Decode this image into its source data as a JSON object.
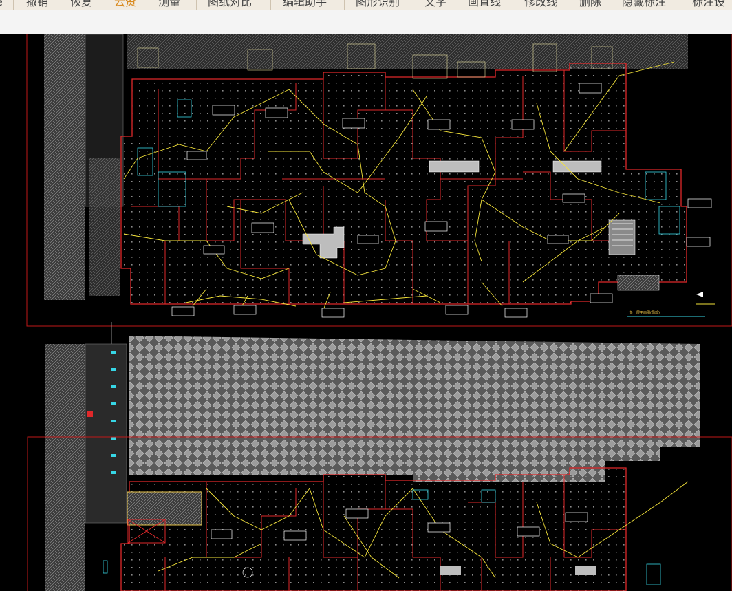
{
  "toolbar": {
    "items": [
      {
        "label": "撤销",
        "active": false
      },
      {
        "label": "恢复",
        "active": false
      },
      {
        "label": "云资",
        "active": true
      },
      {
        "label": "测量",
        "active": false
      },
      {
        "label": "图纸对比",
        "active": false
      },
      {
        "label": "编辑助手",
        "active": false
      },
      {
        "label": "图形识别",
        "active": false
      },
      {
        "label": "文字",
        "active": false
      },
      {
        "label": "画直线",
        "active": false
      },
      {
        "label": "修改线",
        "active": false
      },
      {
        "label": "删除",
        "active": false
      },
      {
        "label": "隐藏标注",
        "active": false
      },
      {
        "label": "标注设",
        "active": false
      }
    ],
    "active_color": "#d98a1f"
  },
  "drawing": {
    "legend_title": "负一层平面图(局部)",
    "background": "#000000",
    "wall_color": "#e0282a",
    "route_color": "#f5e43a",
    "frame_color": "#c01818"
  }
}
